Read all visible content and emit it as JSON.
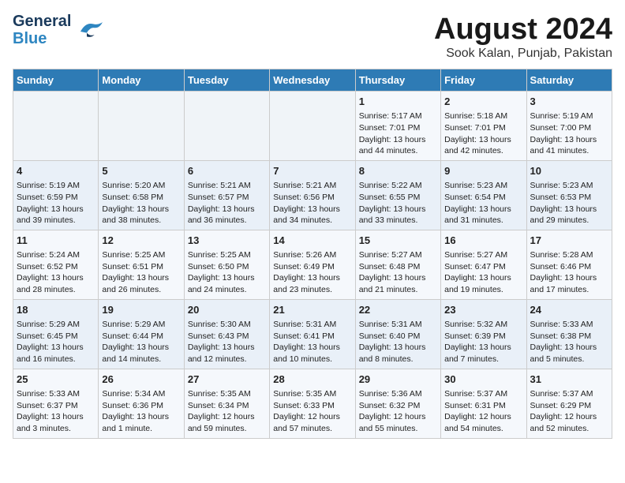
{
  "header": {
    "logo_general": "General",
    "logo_blue": "Blue",
    "title": "August 2024",
    "subtitle": "Sook Kalan, Punjab, Pakistan"
  },
  "days_of_week": [
    "Sunday",
    "Monday",
    "Tuesday",
    "Wednesday",
    "Thursday",
    "Friday",
    "Saturday"
  ],
  "weeks": [
    [
      {
        "day": "",
        "content": ""
      },
      {
        "day": "",
        "content": ""
      },
      {
        "day": "",
        "content": ""
      },
      {
        "day": "",
        "content": ""
      },
      {
        "day": "1",
        "content": "Sunrise: 5:17 AM\nSunset: 7:01 PM\nDaylight: 13 hours\nand 44 minutes."
      },
      {
        "day": "2",
        "content": "Sunrise: 5:18 AM\nSunset: 7:01 PM\nDaylight: 13 hours\nand 42 minutes."
      },
      {
        "day": "3",
        "content": "Sunrise: 5:19 AM\nSunset: 7:00 PM\nDaylight: 13 hours\nand 41 minutes."
      }
    ],
    [
      {
        "day": "4",
        "content": "Sunrise: 5:19 AM\nSunset: 6:59 PM\nDaylight: 13 hours\nand 39 minutes."
      },
      {
        "day": "5",
        "content": "Sunrise: 5:20 AM\nSunset: 6:58 PM\nDaylight: 13 hours\nand 38 minutes."
      },
      {
        "day": "6",
        "content": "Sunrise: 5:21 AM\nSunset: 6:57 PM\nDaylight: 13 hours\nand 36 minutes."
      },
      {
        "day": "7",
        "content": "Sunrise: 5:21 AM\nSunset: 6:56 PM\nDaylight: 13 hours\nand 34 minutes."
      },
      {
        "day": "8",
        "content": "Sunrise: 5:22 AM\nSunset: 6:55 PM\nDaylight: 13 hours\nand 33 minutes."
      },
      {
        "day": "9",
        "content": "Sunrise: 5:23 AM\nSunset: 6:54 PM\nDaylight: 13 hours\nand 31 minutes."
      },
      {
        "day": "10",
        "content": "Sunrise: 5:23 AM\nSunset: 6:53 PM\nDaylight: 13 hours\nand 29 minutes."
      }
    ],
    [
      {
        "day": "11",
        "content": "Sunrise: 5:24 AM\nSunset: 6:52 PM\nDaylight: 13 hours\nand 28 minutes."
      },
      {
        "day": "12",
        "content": "Sunrise: 5:25 AM\nSunset: 6:51 PM\nDaylight: 13 hours\nand 26 minutes."
      },
      {
        "day": "13",
        "content": "Sunrise: 5:25 AM\nSunset: 6:50 PM\nDaylight: 13 hours\nand 24 minutes."
      },
      {
        "day": "14",
        "content": "Sunrise: 5:26 AM\nSunset: 6:49 PM\nDaylight: 13 hours\nand 23 minutes."
      },
      {
        "day": "15",
        "content": "Sunrise: 5:27 AM\nSunset: 6:48 PM\nDaylight: 13 hours\nand 21 minutes."
      },
      {
        "day": "16",
        "content": "Sunrise: 5:27 AM\nSunset: 6:47 PM\nDaylight: 13 hours\nand 19 minutes."
      },
      {
        "day": "17",
        "content": "Sunrise: 5:28 AM\nSunset: 6:46 PM\nDaylight: 13 hours\nand 17 minutes."
      }
    ],
    [
      {
        "day": "18",
        "content": "Sunrise: 5:29 AM\nSunset: 6:45 PM\nDaylight: 13 hours\nand 16 minutes."
      },
      {
        "day": "19",
        "content": "Sunrise: 5:29 AM\nSunset: 6:44 PM\nDaylight: 13 hours\nand 14 minutes."
      },
      {
        "day": "20",
        "content": "Sunrise: 5:30 AM\nSunset: 6:43 PM\nDaylight: 13 hours\nand 12 minutes."
      },
      {
        "day": "21",
        "content": "Sunrise: 5:31 AM\nSunset: 6:41 PM\nDaylight: 13 hours\nand 10 minutes."
      },
      {
        "day": "22",
        "content": "Sunrise: 5:31 AM\nSunset: 6:40 PM\nDaylight: 13 hours\nand 8 minutes."
      },
      {
        "day": "23",
        "content": "Sunrise: 5:32 AM\nSunset: 6:39 PM\nDaylight: 13 hours\nand 7 minutes."
      },
      {
        "day": "24",
        "content": "Sunrise: 5:33 AM\nSunset: 6:38 PM\nDaylight: 13 hours\nand 5 minutes."
      }
    ],
    [
      {
        "day": "25",
        "content": "Sunrise: 5:33 AM\nSunset: 6:37 PM\nDaylight: 13 hours\nand 3 minutes."
      },
      {
        "day": "26",
        "content": "Sunrise: 5:34 AM\nSunset: 6:36 PM\nDaylight: 13 hours\nand 1 minute."
      },
      {
        "day": "27",
        "content": "Sunrise: 5:35 AM\nSunset: 6:34 PM\nDaylight: 12 hours\nand 59 minutes."
      },
      {
        "day": "28",
        "content": "Sunrise: 5:35 AM\nSunset: 6:33 PM\nDaylight: 12 hours\nand 57 minutes."
      },
      {
        "day": "29",
        "content": "Sunrise: 5:36 AM\nSunset: 6:32 PM\nDaylight: 12 hours\nand 55 minutes."
      },
      {
        "day": "30",
        "content": "Sunrise: 5:37 AM\nSunset: 6:31 PM\nDaylight: 12 hours\nand 54 minutes."
      },
      {
        "day": "31",
        "content": "Sunrise: 5:37 AM\nSunset: 6:29 PM\nDaylight: 12 hours\nand 52 minutes."
      }
    ]
  ]
}
